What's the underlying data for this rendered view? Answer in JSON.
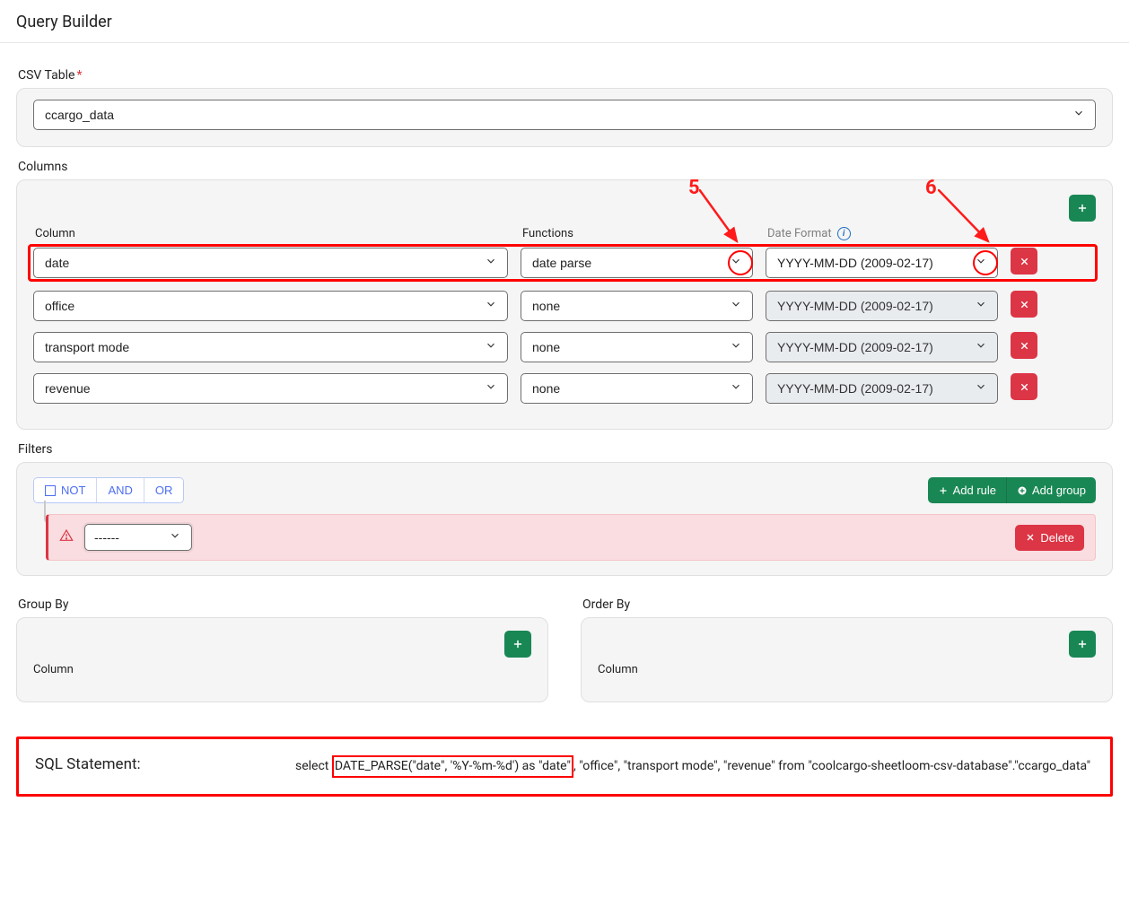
{
  "page": {
    "title": "Query Builder"
  },
  "csv_table": {
    "label": "CSV Table",
    "required": "*",
    "value": "ccargo_data"
  },
  "annotations": {
    "five": "5",
    "six": "6"
  },
  "columns": {
    "label": "Columns",
    "headers": {
      "column": "Column",
      "functions": "Functions",
      "date_format": "Date Format"
    },
    "rows": [
      {
        "column": "date",
        "function": "date parse",
        "date_format": "YYYY-MM-DD (2009-02-17)",
        "df_disabled": false
      },
      {
        "column": "office",
        "function": "none",
        "date_format": "YYYY-MM-DD (2009-02-17)",
        "df_disabled": true
      },
      {
        "column": "transport mode",
        "function": "none",
        "date_format": "YYYY-MM-DD (2009-02-17)",
        "df_disabled": true
      },
      {
        "column": "revenue",
        "function": "none",
        "date_format": "YYYY-MM-DD (2009-02-17)",
        "df_disabled": true
      }
    ]
  },
  "filters": {
    "label": "Filters",
    "ops": {
      "not": "NOT",
      "and": "AND",
      "or": "OR"
    },
    "buttons": {
      "add_rule": "Add rule",
      "add_group": "Add group",
      "delete": "Delete"
    },
    "rule_placeholder": "------"
  },
  "group_by": {
    "label": "Group By",
    "column_header": "Column"
  },
  "order_by": {
    "label": "Order By",
    "column_header": "Column"
  },
  "sql": {
    "label": "SQL Statement:",
    "pre": "select ",
    "highlight": "DATE_PARSE(\"date\", '%Y-%m-%d') as \"date\"",
    "post": ", \"office\", \"transport mode\", \"revenue\" from \"coolcargo-sheetloom-csv-database\".\"ccargo_data\""
  }
}
